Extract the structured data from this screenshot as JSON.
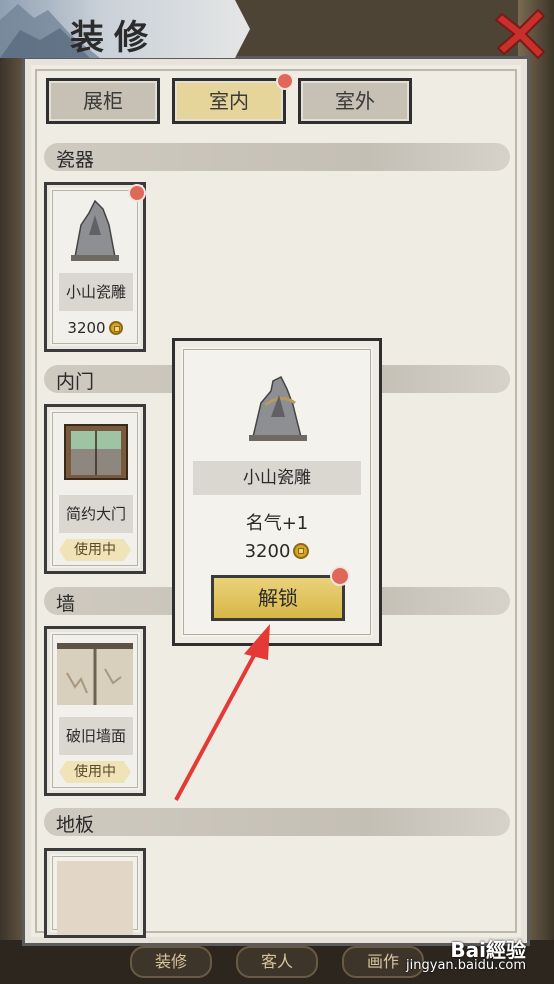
{
  "header": {
    "title": "装修"
  },
  "tabs": [
    {
      "label": "展柜"
    },
    {
      "label": "室内"
    },
    {
      "label": "室外"
    }
  ],
  "sections": {
    "porcelain": "瓷器",
    "inner_door": "内门",
    "wall": "墙",
    "floor": "地板"
  },
  "cards": {
    "porcelain": {
      "name": "小山瓷雕",
      "price": "3200"
    },
    "inner_door": {
      "name": "简约大门",
      "status": "使用中"
    },
    "wall": {
      "name": "破旧墙面",
      "status": "使用中"
    }
  },
  "popup": {
    "name": "小山瓷雕",
    "attribute": "名气+1",
    "price": "3200",
    "unlock_label": "解锁"
  },
  "bottom_nav": [
    "装修",
    "客人",
    "画作"
  ],
  "watermark": {
    "brand": "Bai經验",
    "url": "jingyan.baidu.com"
  },
  "colors": {
    "accent": "#e6d59a",
    "badge": "#e0685a",
    "arrow": "#e53935"
  }
}
